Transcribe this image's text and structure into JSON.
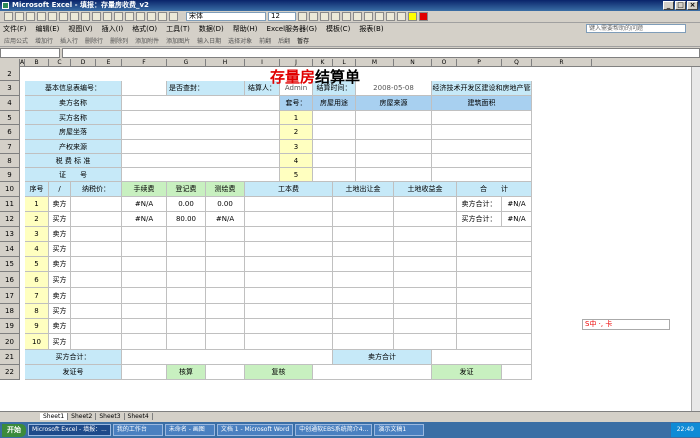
{
  "window": {
    "title": "Microsoft Excel - 填报：存量房收费_v2",
    "buttons": [
      "_",
      "□",
      "×"
    ]
  },
  "font": {
    "name": "宋体",
    "size": "12"
  },
  "menus": [
    "文件(F)",
    "编辑(E)",
    "视图(V)",
    "插入(I)",
    "格式(O)",
    "工具(T)",
    "数据(D)",
    "帮助(H)",
    "Excel服务器(G)",
    "模板(C)",
    "报表(B)"
  ],
  "help_placeholder": "键入需要帮助的问题",
  "toolbar2": [
    "应用公式",
    "增加行",
    "插入行",
    "删除行",
    "删除列",
    "添加附件",
    "添加图片",
    "输入日期",
    "选择对象",
    "前翻",
    "后翻",
    "暂存"
  ],
  "sheet": {
    "title_red": "存量房",
    "title_black": "结算单",
    "columns": [
      "A",
      "B",
      "C",
      "D",
      "E",
      "F",
      "G",
      "H",
      "I",
      "J",
      "K",
      "L",
      "M",
      "N",
      "O",
      "P",
      "Q",
      "R"
    ],
    "rows": [
      "2",
      "3",
      "4",
      "5",
      "6",
      "7",
      "8",
      "9",
      "10",
      "11",
      "12",
      "13",
      "14",
      "15",
      "16",
      "17",
      "18",
      "19",
      "20",
      "21",
      "22"
    ],
    "r3": {
      "info_label": "基本信息表编号：",
      "check_label": "是否查封：",
      "settle_person_label": "结算人：",
      "settle_person": "Admin",
      "settle_time_label": "结算时间：",
      "settle_time": "2008-05-08",
      "org": "兰州经济技术开发区建设和房地产管理局"
    },
    "left_labels": [
      "卖方名称",
      "买方名称",
      "房屋坐落",
      "产权来源",
      "税 费 标 准",
      "证　　号"
    ],
    "r4": {
      "set_no": "套号：",
      "usage": "房屋用途",
      "source": "房屋来源",
      "area": "建筑面积"
    },
    "set_numbers": [
      "1",
      "2",
      "3",
      "4",
      "5"
    ],
    "r10": {
      "seq": "序号",
      "slash": "/",
      "taxpayer": "纳税价：",
      "fee1": "手续费",
      "fee2": "登记费",
      "fee3": "测绘费",
      "fee4": "工本费",
      "fee5": "土地出让金",
      "fee6": "土地收益金",
      "total": "合　　计"
    },
    "r11": {
      "party": "卖方",
      "fee1": "#N/A",
      "fee2": "0.00",
      "fee3": "0.00",
      "total_label": "卖方合计：",
      "total": "#N/A"
    },
    "r12": {
      "party": "买方",
      "fee1": "#N/A",
      "fee2": "80.00",
      "fee3": "#N/A",
      "total_label": "买方合计：",
      "total": "#N/A"
    },
    "seq": [
      "1",
      "2",
      "3",
      "4",
      "5",
      "6",
      "7",
      "8",
      "9",
      "10"
    ],
    "parties": [
      "卖方",
      "买方",
      "卖方",
      "买方",
      "卖方",
      "买方",
      "卖方",
      "买方",
      "卖方",
      "买方"
    ],
    "r21": {
      "buyer_total": "买方合计：",
      "seller_total": "卖方合计"
    },
    "r22": {
      "cert": "发证号",
      "review": "核算",
      "recheck": "复核",
      "issue": "发证"
    }
  },
  "tabs": [
    "Sheet1",
    "Sheet2",
    "Sheet3",
    "Sheet4"
  ],
  "taskbar": {
    "start": "开始",
    "tasks": [
      "Microsoft Excel - 填报：...",
      "我的工作台",
      "未命名 - 画图",
      "文档 1 - Microsoft Word",
      "中创通软EBS系统简介4...",
      "演示文稿1"
    ],
    "clock": "22:49"
  },
  "ime": "S中 ·, 卡"
}
